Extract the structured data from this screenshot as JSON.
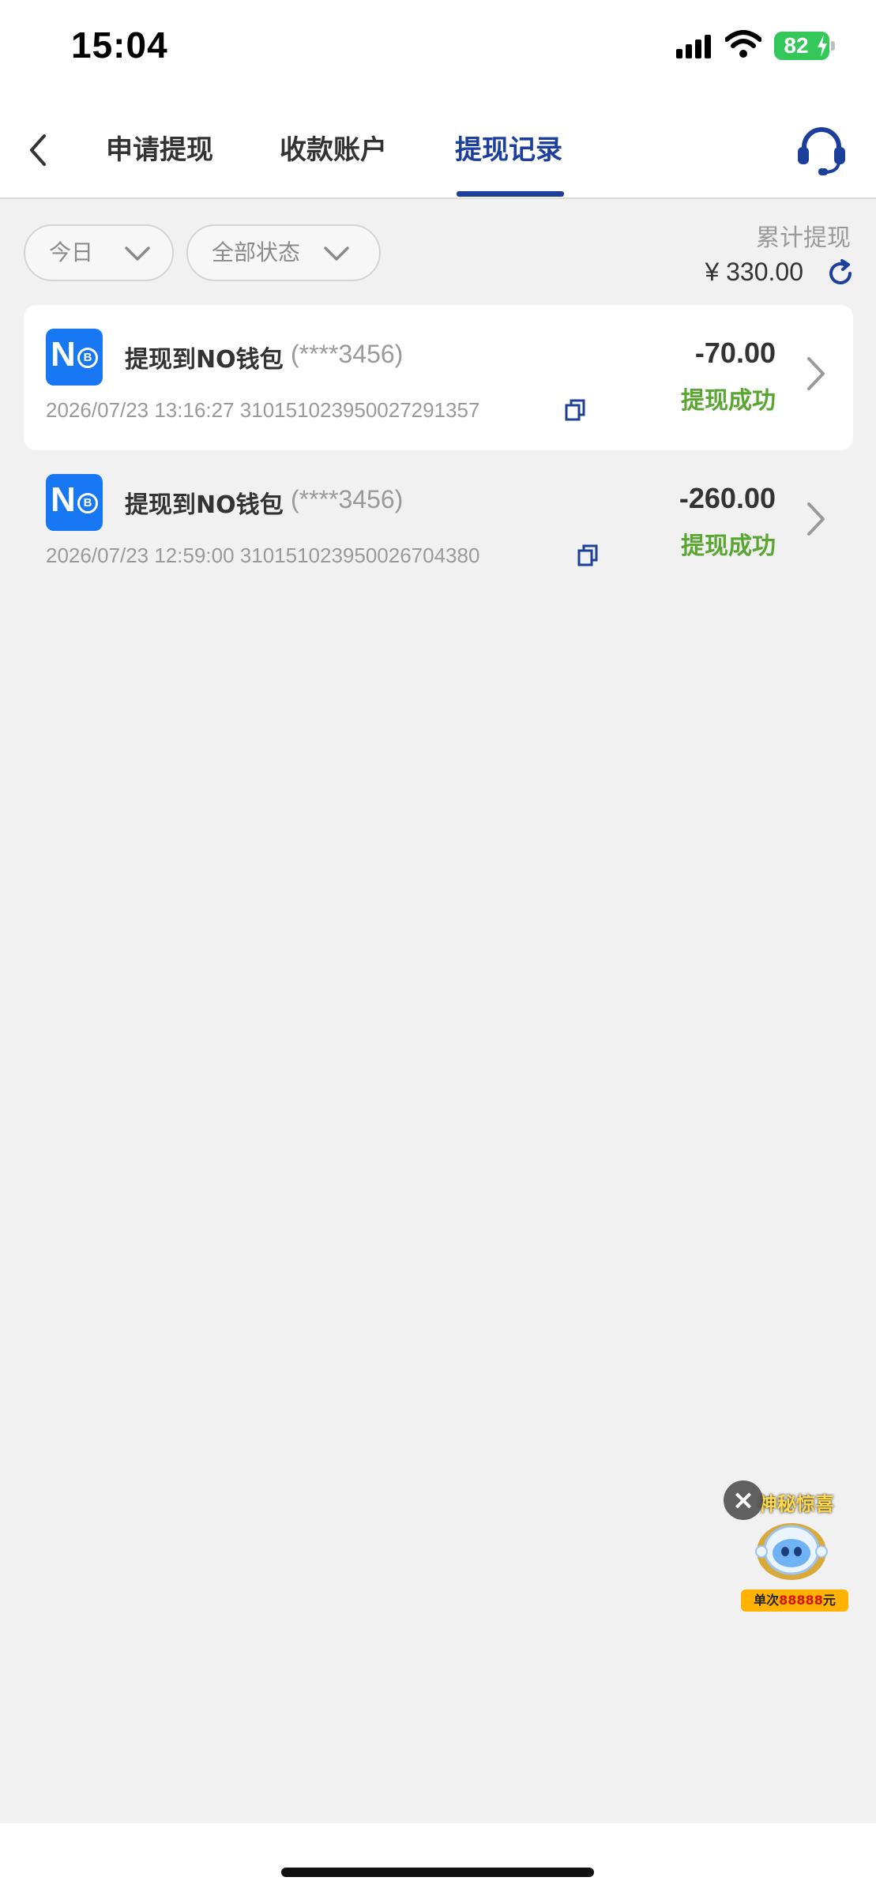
{
  "status_bar": {
    "time": "15:04",
    "battery": "82"
  },
  "nav": {
    "tabs": [
      {
        "label": "申请提现"
      },
      {
        "label": "收款账户"
      },
      {
        "label": "提现记录"
      }
    ],
    "active_tab": 2,
    "accent_color": "#1b3f9b"
  },
  "filters": {
    "date": "今日",
    "status": "全部状态"
  },
  "summary": {
    "label": "累计提现",
    "value": "¥ 330.00"
  },
  "records": [
    {
      "title": "提现到NO钱包",
      "account_mask": "(****3456)",
      "meta": "2026/07/23 13:16:27  310151023950027291357",
      "amount": "-70.00",
      "status": "提现成功"
    },
    {
      "title": "提现到NO钱包",
      "account_mask": "(****3456)",
      "meta": "2026/07/23 12:59:00  310151023950026704380",
      "amount": "-260.00",
      "status": "提现成功"
    }
  ],
  "logo": {
    "letter": "N",
    "badge": "B"
  },
  "promo": {
    "title": "神秘惊喜",
    "badge_prefix": "单次",
    "badge_amount": "88888",
    "badge_suffix": "元"
  },
  "colors": {
    "success": "#5aa632",
    "brand_blue": "#1877f2"
  }
}
